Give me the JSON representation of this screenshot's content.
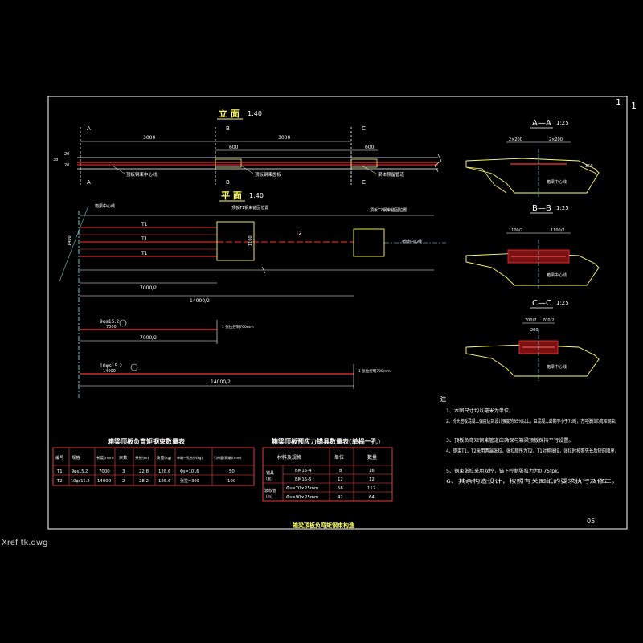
{
  "drawing": {
    "page_number": "1",
    "title_bottom": "箱梁顶板负弯矩钢束构造",
    "sheet_number": "05",
    "xref_label": "Xref tk.dwg"
  },
  "elevation": {
    "title": "立 面",
    "scale": "1:40",
    "sections": [
      "A",
      "A",
      "B",
      "B",
      "C",
      "C"
    ],
    "dims": [
      "3000",
      "3000",
      "600",
      "600"
    ],
    "notes": [
      "顶板钢束中心线",
      "顶板钢束齿板",
      "梁体预留管道"
    ],
    "small_dims": [
      "38",
      "20",
      "20"
    ]
  },
  "plan": {
    "title": "平 面",
    "scale": "1:40",
    "tendons": [
      "T1",
      "T1",
      "T1",
      "T2"
    ],
    "labels": [
      "箱梁中心线",
      "顶板T1钢束锚固位置",
      "顶板T2钢束锚固位置",
      "桥墩中心线"
    ],
    "dims": [
      "7000/2",
      "14000/2",
      "1100"
    ],
    "left_dim": "1400"
  },
  "tendon_details": [
    {
      "spec": "9φs15.2",
      "length": "7000",
      "half_dim": "7000/2",
      "note": "1 张拉控制700mm",
      "id": "1"
    },
    {
      "spec": "10φs15.2",
      "length": "14000",
      "half_dim": "14000/2",
      "note": "1 张拉控制700mm",
      "id": "2"
    }
  ],
  "sections_right": [
    {
      "title": "A—A",
      "scale": "1:25",
      "dims": [
        "2×200",
        "200",
        "2×200",
        "200"
      ],
      "label": "箱梁中心线",
      "side": "350"
    },
    {
      "title": "B—B",
      "scale": "1:25",
      "dims": [
        "1100/2",
        "1100/2",
        "2×200",
        "2×200"
      ],
      "label": "箱梁中心线"
    },
    {
      "title": "C—C",
      "scale": "1:25",
      "dims": [
        "750",
        "750",
        "700/2",
        "700/2",
        "200",
        "200"
      ],
      "label": "箱梁中心线"
    }
  ],
  "notes": {
    "heading": "注",
    "items": [
      "1、本图尺寸均以毫米为单位。",
      "2、桥头搭板混凝土强度达到设计强度的85%以上，且混凝土龄期不小于7d时，方可张拉负弯矩钢束。",
      "3、顶板负弯矩钢束管道应确保与箱梁顶板保持平行设置。",
      "4、钢束T1、T2采用两端张拉，张拉顺序为T2、T1对称张拉，张拉时按照先长后短的顺序。",
      "5、钢束张拉采用双控，锚下控制张拉力为0.75fpk。",
      "6、其余构造设计，按照有关图纸的要求执行及修正。"
    ]
  },
  "table1": {
    "title": "箱梁顶板负弯矩钢束数量表",
    "headers": [
      "编号",
      "规格",
      "长度(mm)",
      "束数",
      "共长(m)",
      "质量(kg)",
      "单端一孔合计(kg)",
      "引伸量(两端)(mm)"
    ],
    "rows": [
      [
        "T1",
        "9φs15.2",
        "7000",
        "3",
        "22.8",
        "128.6",
        "Φs=1016",
        "50"
      ],
      [
        "T2",
        "10φs15.2",
        "14000",
        "2",
        "28.2",
        "125.6",
        "张拉=300",
        "100"
      ]
    ]
  },
  "table2": {
    "title": "箱梁顶板预应力锚具数量表(单榀一孔)",
    "headers": [
      "材料及规格",
      "单位",
      "数量"
    ],
    "rows": [
      [
        "BM15-4",
        "套",
        "16"
      ],
      [
        "BM15-5",
        "套",
        "12"
      ],
      [
        "Φs=70×25mm",
        "米",
        "112"
      ],
      [
        "Φs=90×25mm",
        "米",
        "64"
      ]
    ],
    "row_groups": [
      "锚具",
      "(套)",
      "波纹管",
      "(m)"
    ],
    "extra_counts": [
      "8",
      "12",
      "56",
      "42"
    ]
  }
}
